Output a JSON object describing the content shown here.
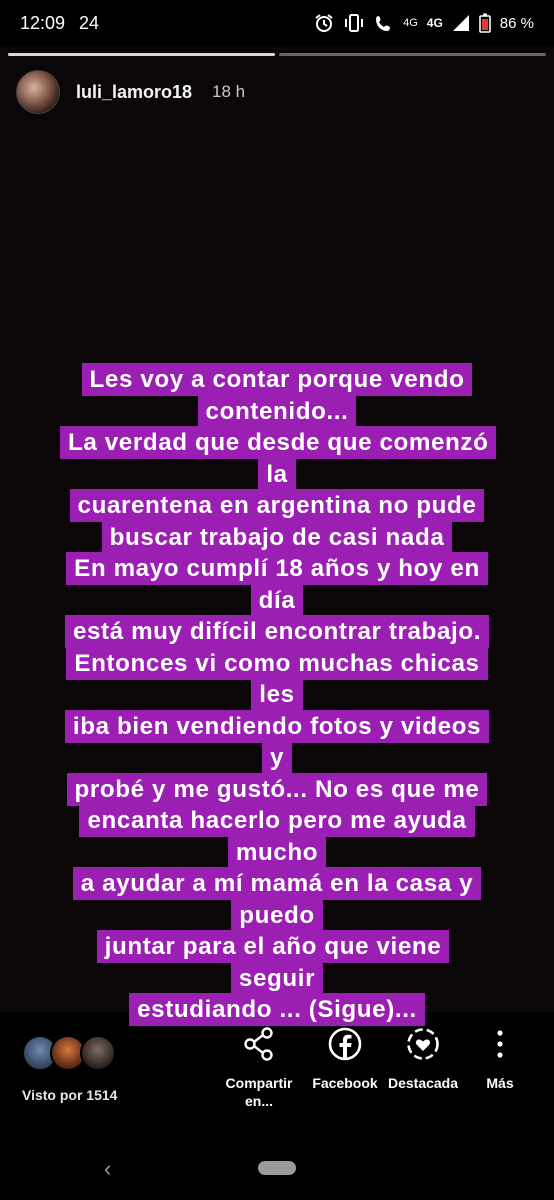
{
  "status_bar": {
    "time": "12:09",
    "notification": "24",
    "network_a": "4G",
    "network_b": "4G",
    "battery": "86 %",
    "icons": [
      "alarm-icon",
      "vibrate-icon",
      "wifi-calling-icon",
      "signal-icon",
      "battery-icon"
    ]
  },
  "story": {
    "username": "luli_lamoro18",
    "time_ago": "18 h",
    "progress": {
      "segments": 2,
      "current": 1
    },
    "caption": [
      "Les voy a contar porque vendo",
      "contenido...",
      "La verdad que desde que comenzó la",
      "cuarentena en argentina no pude",
      "buscar trabajo de casi nada",
      "En mayo cumplí 18 años y hoy en día",
      "está muy difícil encontrar trabajo.",
      "Entonces vi como muchas chicas les",
      "iba bien vendiendo fotos y videos y",
      "probé y me gustó... No es que me",
      "encanta hacerlo pero me ayuda mucho",
      "a ayudar a mí mamá en la casa y puedo",
      "juntar para el año que viene seguir",
      "estudiando ... (Sigue)..."
    ],
    "caption_color": "#9b1fb3"
  },
  "footer": {
    "seen_by": "Visto por 1514",
    "actions": {
      "share": "Compartir en...",
      "share_line1": "Compartir",
      "share_line2": "en...",
      "facebook": "Facebook",
      "highlight": "Destacada",
      "more": "Más"
    }
  }
}
